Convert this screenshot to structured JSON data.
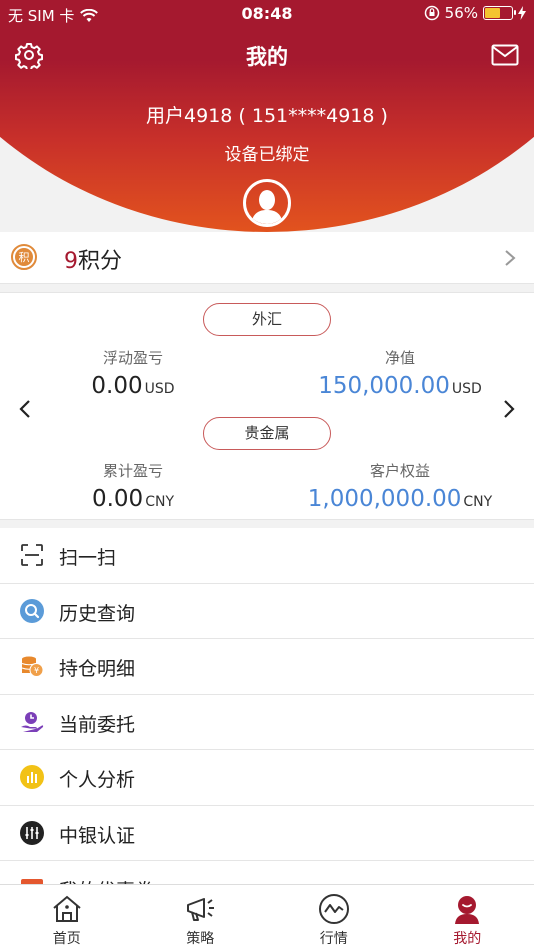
{
  "status_bar": {
    "carrier": "无 SIM 卡",
    "time": "08:48",
    "battery": "56%",
    "battery_level": 0.56
  },
  "header": {
    "title": "我的",
    "user_name": "用户4918 ( 151****4918 )",
    "device_status": "设备已绑定"
  },
  "points": {
    "value": "9",
    "label": "积分",
    "icon_char": "积"
  },
  "account": {
    "forex": {
      "tag": "外汇",
      "left_label": "浮动盈亏",
      "left_value": "0.00",
      "left_unit": "USD",
      "right_label": "净值",
      "right_value": "150,000.00",
      "right_unit": "USD"
    },
    "metal": {
      "tag": "贵金属",
      "left_label": "累计盈亏",
      "left_value": "0.00",
      "left_unit": "CNY",
      "right_label": "客户权益",
      "right_value": "1,000,000.00",
      "right_unit": "CNY"
    },
    "accent_blue": "#4a86d6"
  },
  "menu": [
    {
      "label": "扫一扫",
      "icon": "scan-icon"
    },
    {
      "label": "历史查询",
      "icon": "search-history-icon"
    },
    {
      "label": "持仓明细",
      "icon": "coins-icon"
    },
    {
      "label": "当前委托",
      "icon": "hand-clock-icon"
    },
    {
      "label": "个人分析",
      "icon": "bar-chart-icon"
    },
    {
      "label": "中银认证",
      "icon": "equalizer-icon"
    },
    {
      "label": "我的优惠券",
      "icon": "coupon-icon"
    }
  ],
  "tabs": [
    {
      "label": "首页",
      "icon": "home-icon"
    },
    {
      "label": "策略",
      "icon": "megaphone-icon"
    },
    {
      "label": "行情",
      "icon": "chart-line-icon"
    },
    {
      "label": "我的",
      "icon": "profile-icon",
      "active": true
    }
  ],
  "colors": {
    "brand": "#a5192f",
    "header_bottom": "#e2531e"
  }
}
